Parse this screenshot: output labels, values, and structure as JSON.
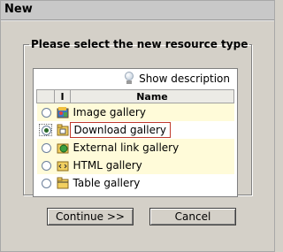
{
  "dialog": {
    "title": "New",
    "group_title": "Please select the new resource type",
    "show_description": "Show description",
    "columns": {
      "radio": "",
      "icon": "I",
      "name": "Name"
    },
    "items": [
      {
        "label": "Image gallery",
        "icon": "image-gallery-icon",
        "checked": false
      },
      {
        "label": "Download gallery",
        "icon": "download-gallery-icon",
        "checked": true
      },
      {
        "label": "External link gallery",
        "icon": "external-link-gallery-icon",
        "checked": false
      },
      {
        "label": "HTML gallery",
        "icon": "html-gallery-icon",
        "checked": false
      },
      {
        "label": "Table gallery",
        "icon": "table-gallery-icon",
        "checked": false
      }
    ],
    "continue_label": "Continue >>",
    "cancel_label": "Cancel"
  }
}
